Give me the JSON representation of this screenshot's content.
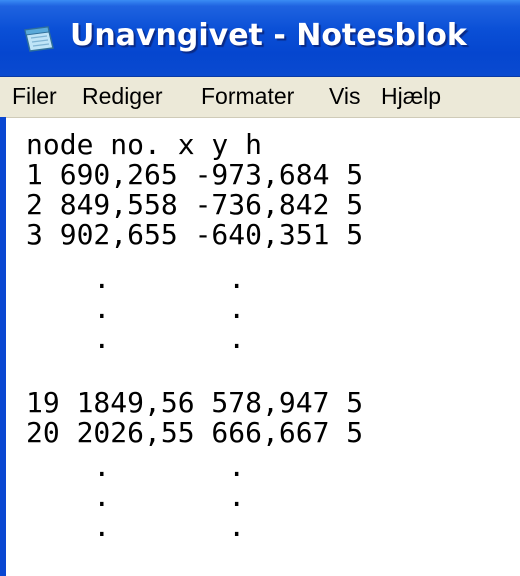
{
  "window": {
    "title": "Unavngivet - Notesblok",
    "icon": "notepad-icon",
    "colors": {
      "titlebar": "#0a4fd6",
      "menubar": "#ece9d8",
      "text": "#000000"
    }
  },
  "menu": {
    "items": [
      "Filer",
      "Rediger",
      "Formater",
      "Vis",
      "Hjælp"
    ]
  },
  "editor": {
    "lines": [
      "node no. x y h",
      "1 690,265 -973,684 5",
      "2 849,558 -736,842 5",
      "3 902,655 -640,351 5",
      "    .       .",
      "    .       .",
      "    .       .",
      "",
      "19 1849,56 578,947 5",
      "20 2026,55 666,667 5",
      "    .       .",
      "    .       .",
      "    .       ."
    ]
  }
}
